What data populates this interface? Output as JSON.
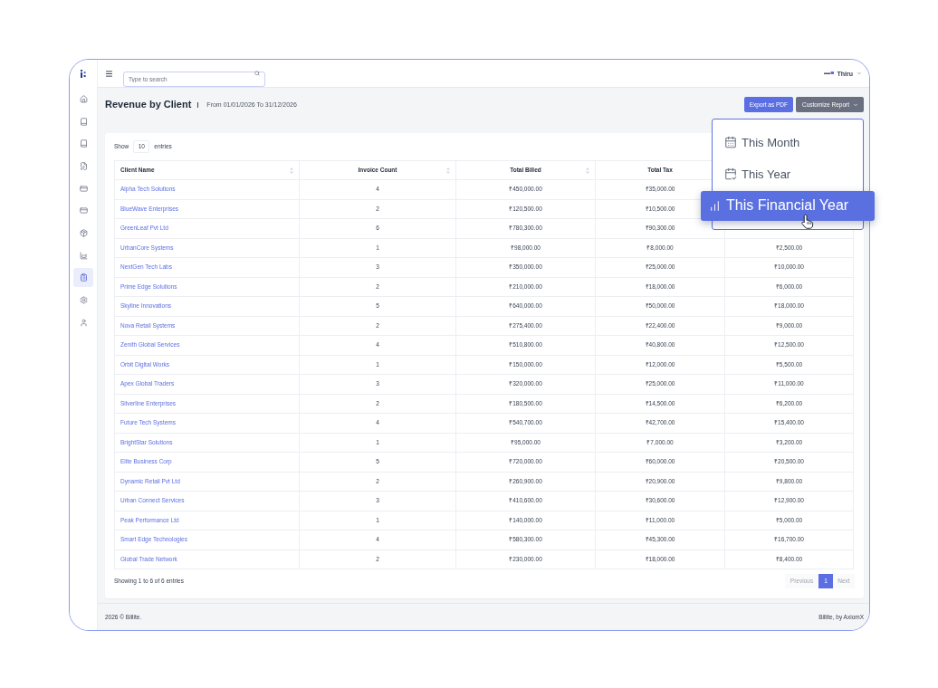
{
  "sidebar": {
    "items": [
      {
        "selected": false
      },
      {
        "selected": false
      },
      {
        "selected": false
      },
      {
        "selected": false
      },
      {
        "selected": false
      },
      {
        "selected": false
      },
      {
        "selected": false
      },
      {
        "selected": false
      },
      {
        "selected": true
      },
      {
        "selected": false
      },
      {
        "selected": false
      }
    ]
  },
  "topbar": {
    "search": {
      "placeholder": "Type to search"
    },
    "user": {
      "name": "Thiru"
    }
  },
  "page_header": {
    "title": "Revenue by Client",
    "date_range": "From 01/01/2026 To 31/12/2026",
    "buttons": [
      {
        "label": "Export as PDF",
        "kind": "primary"
      },
      {
        "label": "Customize Report",
        "kind": "dropdown"
      }
    ]
  },
  "dropdown_menu": {
    "items": [
      {
        "label": "This Month",
        "selected": false
      },
      {
        "label": "This Year",
        "selected": false
      },
      {
        "label": "This Financial Year",
        "selected": true
      }
    ]
  },
  "table": {
    "length_menu": {
      "prefix": "Show",
      "value": "10",
      "suffix": "entries"
    },
    "columns": [
      {
        "label": "Client Name",
        "sortable": true
      },
      {
        "label": "Invoice Count",
        "sortable": true
      },
      {
        "label": "Total Billed",
        "sortable": true
      },
      {
        "label": "Total Tax",
        "sortable": false
      }
    ],
    "rows": [
      {
        "cells": [
          "Alpha Tech Solutions",
          "4",
          "₹450,000.00",
          "₹35,000.00"
        ]
      },
      {
        "cells": [
          "BlueWave Enterprises",
          "2",
          "₹120,500.00",
          "₹10,500.00"
        ]
      },
      {
        "cells": [
          "GreenLeaf Pvt Ltd",
          "6",
          "₹780,300.00",
          "₹90,300.00"
        ]
      },
      {
        "cells": [
          "UrbanCore Systems",
          "1",
          "₹98,000.00",
          "₹8,000.00",
          "₹2,500.00"
        ]
      },
      {
        "cells": [
          "NextGen Tech Labs",
          "3",
          "₹350,000.00",
          "₹25,000.00",
          "₹10,000.00"
        ]
      },
      {
        "cells": [
          "Prime Edge Solutions",
          "2",
          "₹210,000.00",
          "₹18,000.00",
          "₹6,000.00"
        ]
      },
      {
        "cells": [
          "Skyline Innovations",
          "5",
          "₹640,000.00",
          "₹50,000.00",
          "₹18,000.00"
        ]
      },
      {
        "cells": [
          "Nova Retail Systems",
          "2",
          "₹275,400.00",
          "₹22,400.00",
          "₹9,000.00"
        ]
      },
      {
        "cells": [
          "Zenith Global Services",
          "4",
          "₹510,800.00",
          "₹40,800.00",
          "₹12,500.00"
        ]
      },
      {
        "cells": [
          "Orbit Digital Works",
          "1",
          "₹150,000.00",
          "₹12,000.00",
          "₹5,500.00"
        ]
      },
      {
        "cells": [
          "Apex Global Traders",
          "3",
          "₹320,000.00",
          "₹25,000.00",
          "₹11,000.00"
        ]
      },
      {
        "cells": [
          "Silverline Enterprises",
          "2",
          "₹180,500.00",
          "₹14,500.00",
          "₹6,200.00"
        ]
      },
      {
        "cells": [
          "Future Tech Systems",
          "4",
          "₹540,700.00",
          "₹42,700.00",
          "₹15,400.00"
        ]
      },
      {
        "cells": [
          "BrightStar Solutions",
          "1",
          "₹95,000.00",
          "₹7,000.00",
          "₹3,200.00"
        ]
      },
      {
        "cells": [
          "Elite Business Corp",
          "5",
          "₹720,000.00",
          "₹60,000.00",
          "₹20,500.00"
        ]
      },
      {
        "cells": [
          "Dynamic Retail Pvt Ltd",
          "2",
          "₹260,900.00",
          "₹20,900.00",
          "₹9,800.00"
        ]
      },
      {
        "cells": [
          "Urban Connect Services",
          "3",
          "₹410,600.00",
          "₹30,600.00",
          "₹12,900.00"
        ]
      },
      {
        "cells": [
          "Peak Performance Ltd",
          "1",
          "₹140,000.00",
          "₹11,000.00",
          "₹5,000.00"
        ]
      },
      {
        "cells": [
          "Smart Edge Technologies",
          "4",
          "₹580,300.00",
          "₹45,300.00",
          "₹16,700.00"
        ]
      },
      {
        "cells": [
          "Global Trade Network",
          "2",
          "₹230,000.00",
          "₹18,000.00",
          "₹8,400.00"
        ]
      }
    ],
    "info": "Showing 1 to 6 of 6 entries",
    "pagination": {
      "previous": {
        "label": "Previous",
        "disabled": true
      },
      "pages": [
        {
          "label": "1",
          "selected": true
        }
      ],
      "next": {
        "label": "Next",
        "disabled": true
      }
    }
  },
  "footer": {
    "copyright": "2026 © Billite.",
    "credit": "Billite, by AxiomX"
  }
}
